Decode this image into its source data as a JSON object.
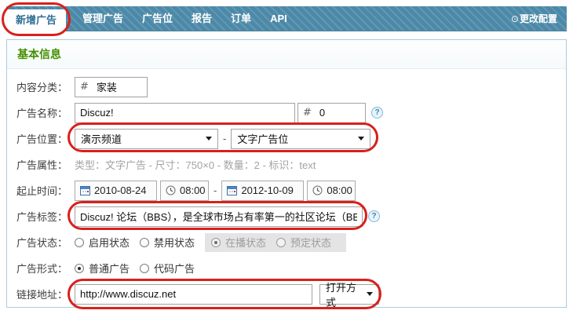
{
  "nav": {
    "tabs": {
      "active": "新增广告",
      "t1": "管理广告",
      "t2": "广告位",
      "t3": "报告",
      "t4": "订单",
      "t5": "API"
    },
    "config_icon": "⊙",
    "config_label": "更改配置"
  },
  "panel": {
    "title": "基本信息",
    "category": {
      "label": "内容分类：",
      "prefix": "#",
      "value": "家装"
    },
    "name": {
      "label": "广告名称：",
      "value": "Discuz!",
      "prefix": "#",
      "order_value": "0",
      "help_icon": "?"
    },
    "position": {
      "label": "广告位置：",
      "channel": "演示频道",
      "separator": "-",
      "slot": "文字广告位"
    },
    "attrs": {
      "label": "广告属性：",
      "value": "类型：文字广告 - 尺寸：750×0 - 数量：2 - 标识：text"
    },
    "time": {
      "label": "起止时间：",
      "start_date": "2010-08-24",
      "start_time": "08:00",
      "separator": "-",
      "end_date": "2012-10-09",
      "end_time": "08:00"
    },
    "tag": {
      "label": "广告标签：",
      "value": "Discuz! 论坛（BBS），是全球市场占有率第一的社区论坛（BBS）软",
      "help_icon": "?"
    },
    "status": {
      "label": "广告状态：",
      "options": [
        {
          "label": "启用状态",
          "checked": false,
          "disabled": false
        },
        {
          "label": "禁用状态",
          "checked": false,
          "disabled": false
        },
        {
          "label": "在播状态",
          "checked": true,
          "disabled": true
        },
        {
          "label": "预定状态",
          "checked": false,
          "disabled": true
        }
      ]
    },
    "form_type": {
      "label": "广告形式：",
      "options": [
        {
          "label": "普通广告",
          "checked": true
        },
        {
          "label": "代码广告",
          "checked": false
        }
      ]
    },
    "link": {
      "label": "链接地址：",
      "value": "http://www.discuz.net",
      "open_mode": "打开方式"
    }
  },
  "colors": {
    "navbar_blue": "#4c89a8",
    "active_tab_text": "#2e6f93",
    "section_green": "#459000",
    "annotation_red": "#d8201c",
    "disabled_gray": "#e4e4e4",
    "panel_border": "#a9cdde"
  }
}
